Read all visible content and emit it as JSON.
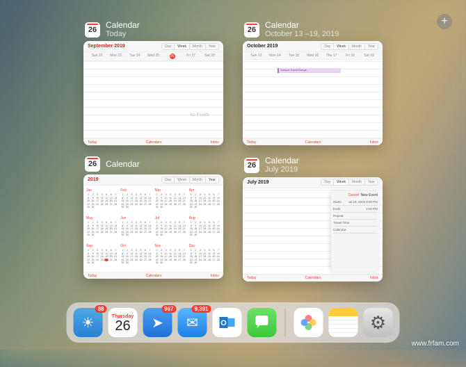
{
  "app_name": "Calendar",
  "add_button_label": "+",
  "windows": [
    {
      "id": "today",
      "title": "Calendar",
      "subtitle": "Today",
      "header": "September 2019",
      "view_segments": [
        "Day",
        "Week",
        "Month",
        "Year"
      ],
      "active_segment": "Week",
      "day_labels": [
        "Sun 22",
        "Mon 23",
        "Tue 24",
        "Wed 25",
        "Thu 26",
        "Fri 27",
        "Sat 28"
      ],
      "today_index": 4,
      "empty_text": "No Events",
      "footer": {
        "left": "Today",
        "center": "Calendars",
        "right": "Inbox"
      }
    },
    {
      "id": "oct",
      "title": "Calendar",
      "subtitle": "October 13 –19, 2019",
      "header": "October 2019",
      "view_segments": [
        "Day",
        "Week",
        "Month",
        "Year"
      ],
      "active_segment": "Week",
      "day_labels": [
        "Sun 13",
        "Mon 14",
        "Tue 15",
        "Wed 16",
        "Thu 17",
        "Fri 18",
        "Sat 19"
      ],
      "event_label": "Sample Event Range",
      "footer": {
        "left": "Today",
        "center": "Calendars",
        "right": "Inbox"
      }
    },
    {
      "id": "year",
      "title": "Calendar",
      "subtitle": "",
      "header": "2019",
      "view_segments": [
        "Day",
        "Week",
        "Month",
        "Year"
      ],
      "active_segment": "Year",
      "months": [
        "Jan",
        "Feb",
        "Mar",
        "Apr",
        "May",
        "Jun",
        "Jul",
        "Aug",
        "Sep",
        "Oct",
        "Nov",
        "Dec"
      ],
      "footer": {
        "left": "Today",
        "center": "Calendars",
        "right": "Inbox"
      }
    },
    {
      "id": "july",
      "title": "Calendar",
      "subtitle": "July 2019",
      "header": "July 2019",
      "view_segments": [
        "Day",
        "Week",
        "Month",
        "Year"
      ],
      "active_segment": "Week",
      "editor": {
        "cancel": "Cancel",
        "title": "New Event",
        "fields": [
          {
            "label": "Starts",
            "value": "Jul 18, 2019  9:00 PM"
          },
          {
            "label": "Ends",
            "value": "2:00 PM"
          },
          {
            "label": "Repeat",
            "value": ""
          },
          {
            "label": "Travel Time",
            "value": ""
          },
          {
            "label": "Calendar",
            "value": ""
          }
        ]
      },
      "footer": {
        "left": "Today",
        "center": "Calendars",
        "right": "Inbox"
      }
    }
  ],
  "cal_icon_day": "26",
  "dock": {
    "left": [
      {
        "name": "weather",
        "badge": "88",
        "icon": "☀"
      },
      {
        "name": "calendar",
        "dow": "Thursday",
        "dnum": "26"
      },
      {
        "name": "send",
        "badge": "967",
        "icon": "➤"
      },
      {
        "name": "mail",
        "badge": "9,391",
        "icon": "✉"
      },
      {
        "name": "outlook",
        "icon": "O"
      },
      {
        "name": "messages",
        "icon": "💬"
      }
    ],
    "right": [
      {
        "name": "photos",
        "icon": "✿"
      },
      {
        "name": "notes"
      },
      {
        "name": "settings",
        "icon": "⚙"
      }
    ]
  },
  "watermark": "www.frfam.com"
}
